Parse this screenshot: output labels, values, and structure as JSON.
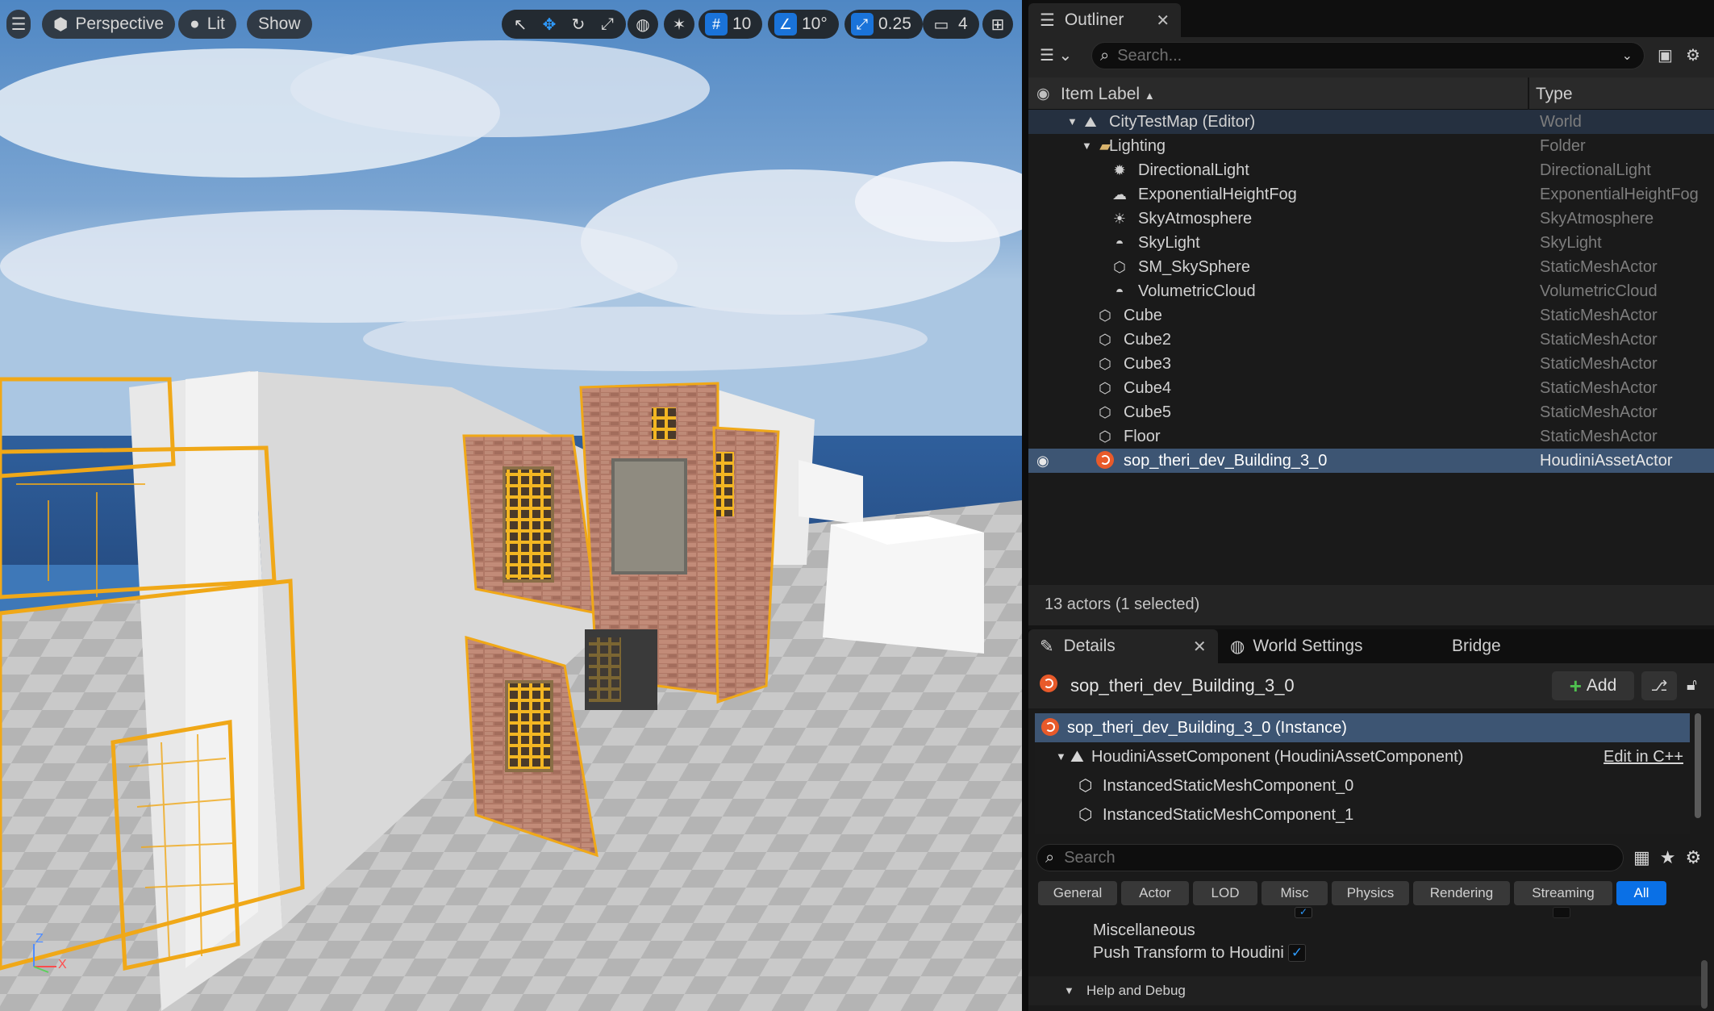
{
  "viewport": {
    "view_mode": "Perspective",
    "lighting_mode": "Lit",
    "show_label": "Show",
    "grid_snap": "10",
    "rotation_snap": "10°",
    "scale_snap": "0.25",
    "camera_speed": "4",
    "axis": {
      "z": "Z",
      "x": "X"
    }
  },
  "outliner": {
    "tab_label": "Outliner",
    "search_placeholder": "Search...",
    "col_item_label": "Item Label",
    "col_type": "Type",
    "rows": [
      {
        "label": "CityTestMap (Editor)",
        "type": "World"
      },
      {
        "label": "Lighting",
        "type": "Folder"
      },
      {
        "label": "DirectionalLight",
        "type": "DirectionalLight"
      },
      {
        "label": "ExponentialHeightFog",
        "type": "ExponentialHeightFog"
      },
      {
        "label": "SkyAtmosphere",
        "type": "SkyAtmosphere"
      },
      {
        "label": "SkyLight",
        "type": "SkyLight"
      },
      {
        "label": "SM_SkySphere",
        "type": "StaticMeshActor"
      },
      {
        "label": "VolumetricCloud",
        "type": "VolumetricCloud"
      },
      {
        "label": "Cube",
        "type": "StaticMeshActor"
      },
      {
        "label": "Cube2",
        "type": "StaticMeshActor"
      },
      {
        "label": "Cube3",
        "type": "StaticMeshActor"
      },
      {
        "label": "Cube4",
        "type": "StaticMeshActor"
      },
      {
        "label": "Cube5",
        "type": "StaticMeshActor"
      },
      {
        "label": "Floor",
        "type": "StaticMeshActor"
      },
      {
        "label": "sop_theri_dev_Building_3_0",
        "type": "HoudiniAssetActor"
      }
    ],
    "actor_count": "13 actors (1 selected)"
  },
  "details": {
    "tab_details": "Details",
    "tab_world_settings": "World Settings",
    "tab_bridge": "Bridge",
    "actor_name": "sop_theri_dev_Building_3_0",
    "add_label": "Add",
    "components": [
      {
        "label": "sop_theri_dev_Building_3_0 (Instance)"
      },
      {
        "label": "HoudiniAssetComponent (HoudiniAssetComponent)"
      },
      {
        "label": "InstancedStaticMeshComponent_0"
      },
      {
        "label": "InstancedStaticMeshComponent_1"
      }
    ],
    "edit_cpp": "Edit in C++",
    "search_placeholder": "Search",
    "filters": [
      "General",
      "Actor",
      "LOD",
      "Misc",
      "Physics",
      "Rendering",
      "Streaming",
      "All"
    ],
    "misc_label": "Miscellaneous",
    "push_transform_label": "Push Transform to Houdini",
    "help_debug": "Help and Debug"
  },
  "colors": {
    "accent": "#0a70e6",
    "selection": "#3d5573",
    "houdini": "#e85a2a",
    "outline": "#f0a818"
  }
}
